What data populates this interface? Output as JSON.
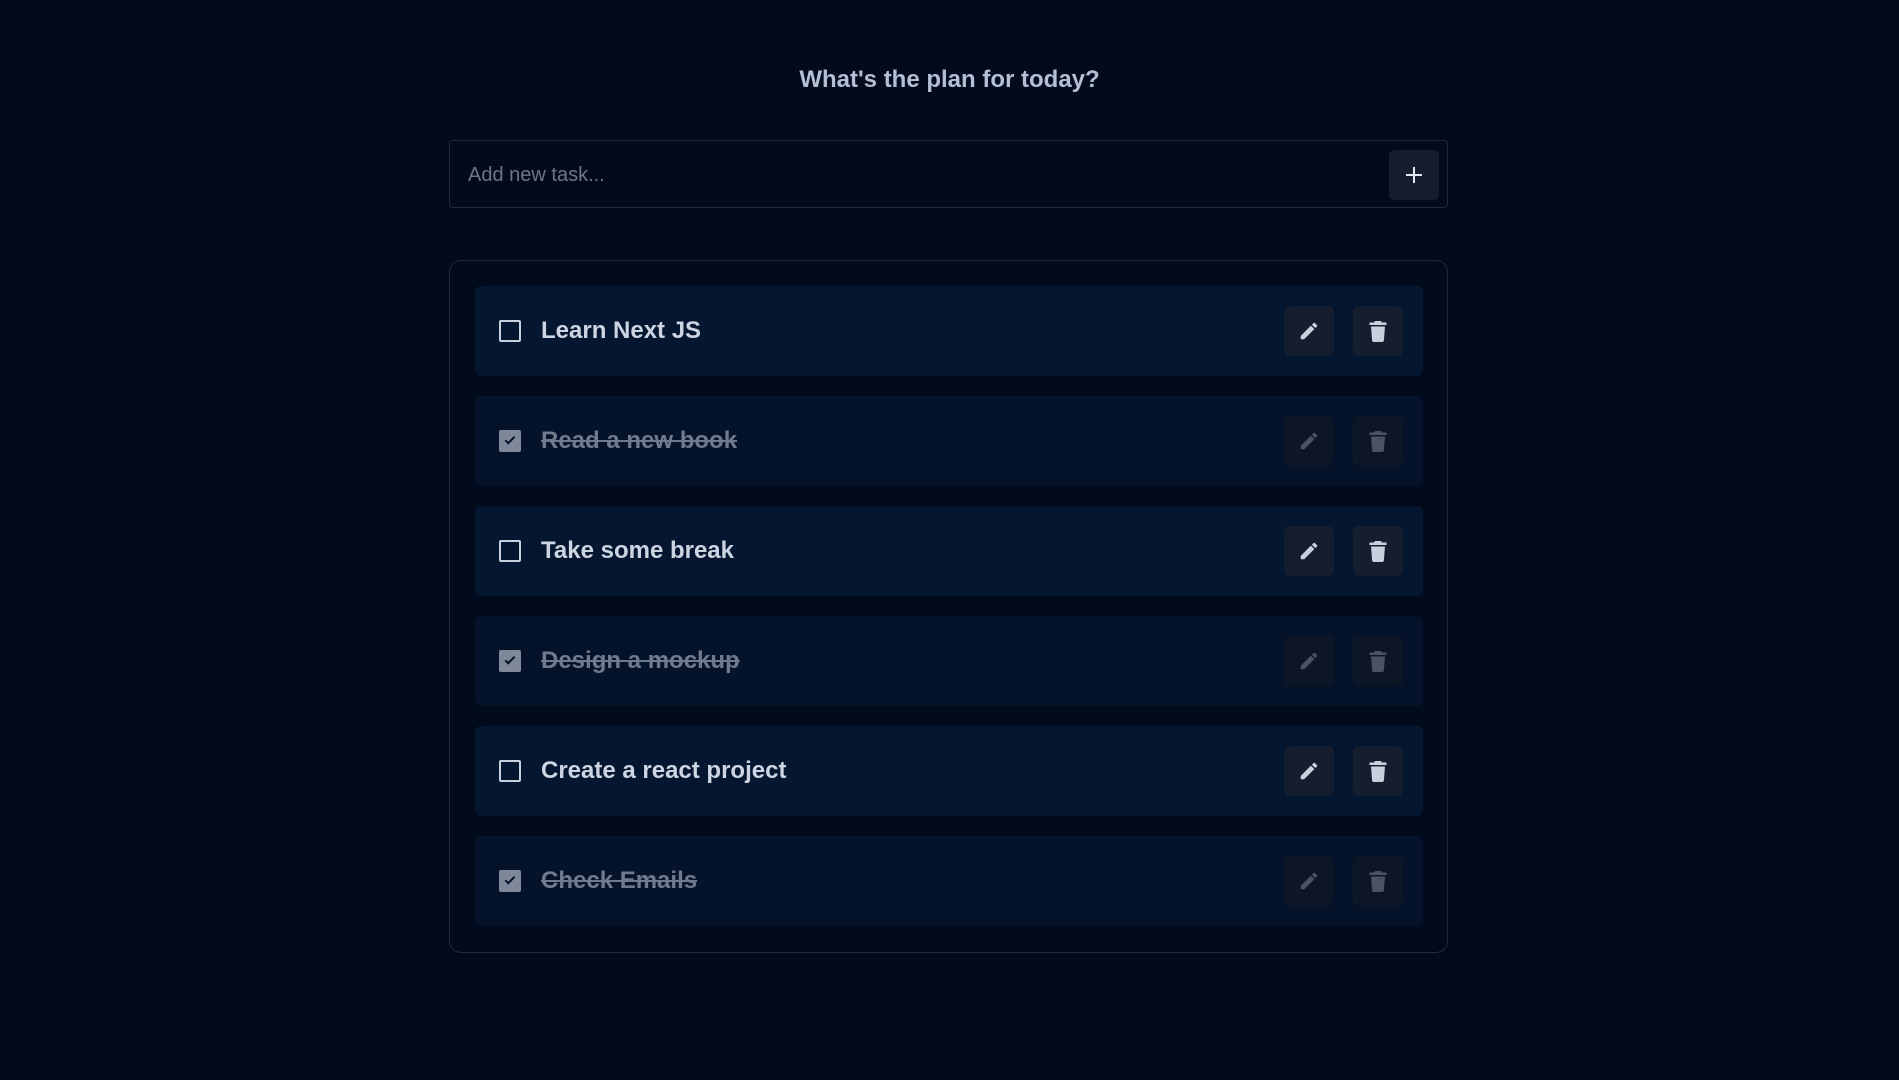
{
  "header": {
    "title": "What's the plan for today?"
  },
  "new_task": {
    "placeholder": "Add new task...",
    "value": "",
    "add_icon": "plus-icon"
  },
  "tasks": [
    {
      "title": "Learn Next JS",
      "completed": false,
      "edit_icon": "pencil-icon",
      "delete_icon": "trash-icon"
    },
    {
      "title": "Read a new book",
      "completed": true,
      "edit_icon": "pencil-icon",
      "delete_icon": "trash-icon"
    },
    {
      "title": "Take some break",
      "completed": false,
      "edit_icon": "pencil-icon",
      "delete_icon": "trash-icon"
    },
    {
      "title": "Design a mockup",
      "completed": true,
      "edit_icon": "pencil-icon",
      "delete_icon": "trash-icon"
    },
    {
      "title": "Create a react project",
      "completed": false,
      "edit_icon": "pencil-icon",
      "delete_icon": "trash-icon"
    },
    {
      "title": "Check Emails",
      "completed": true,
      "edit_icon": "pencil-icon",
      "delete_icon": "trash-icon"
    }
  ],
  "colors": {
    "background": "#020b1c",
    "task_active_bg": "#041630",
    "task_done_bg": "#04122a",
    "text_primary": "#cdd5e3",
    "text_done": "#6f7a8d",
    "button_bg": "#151e2e"
  }
}
